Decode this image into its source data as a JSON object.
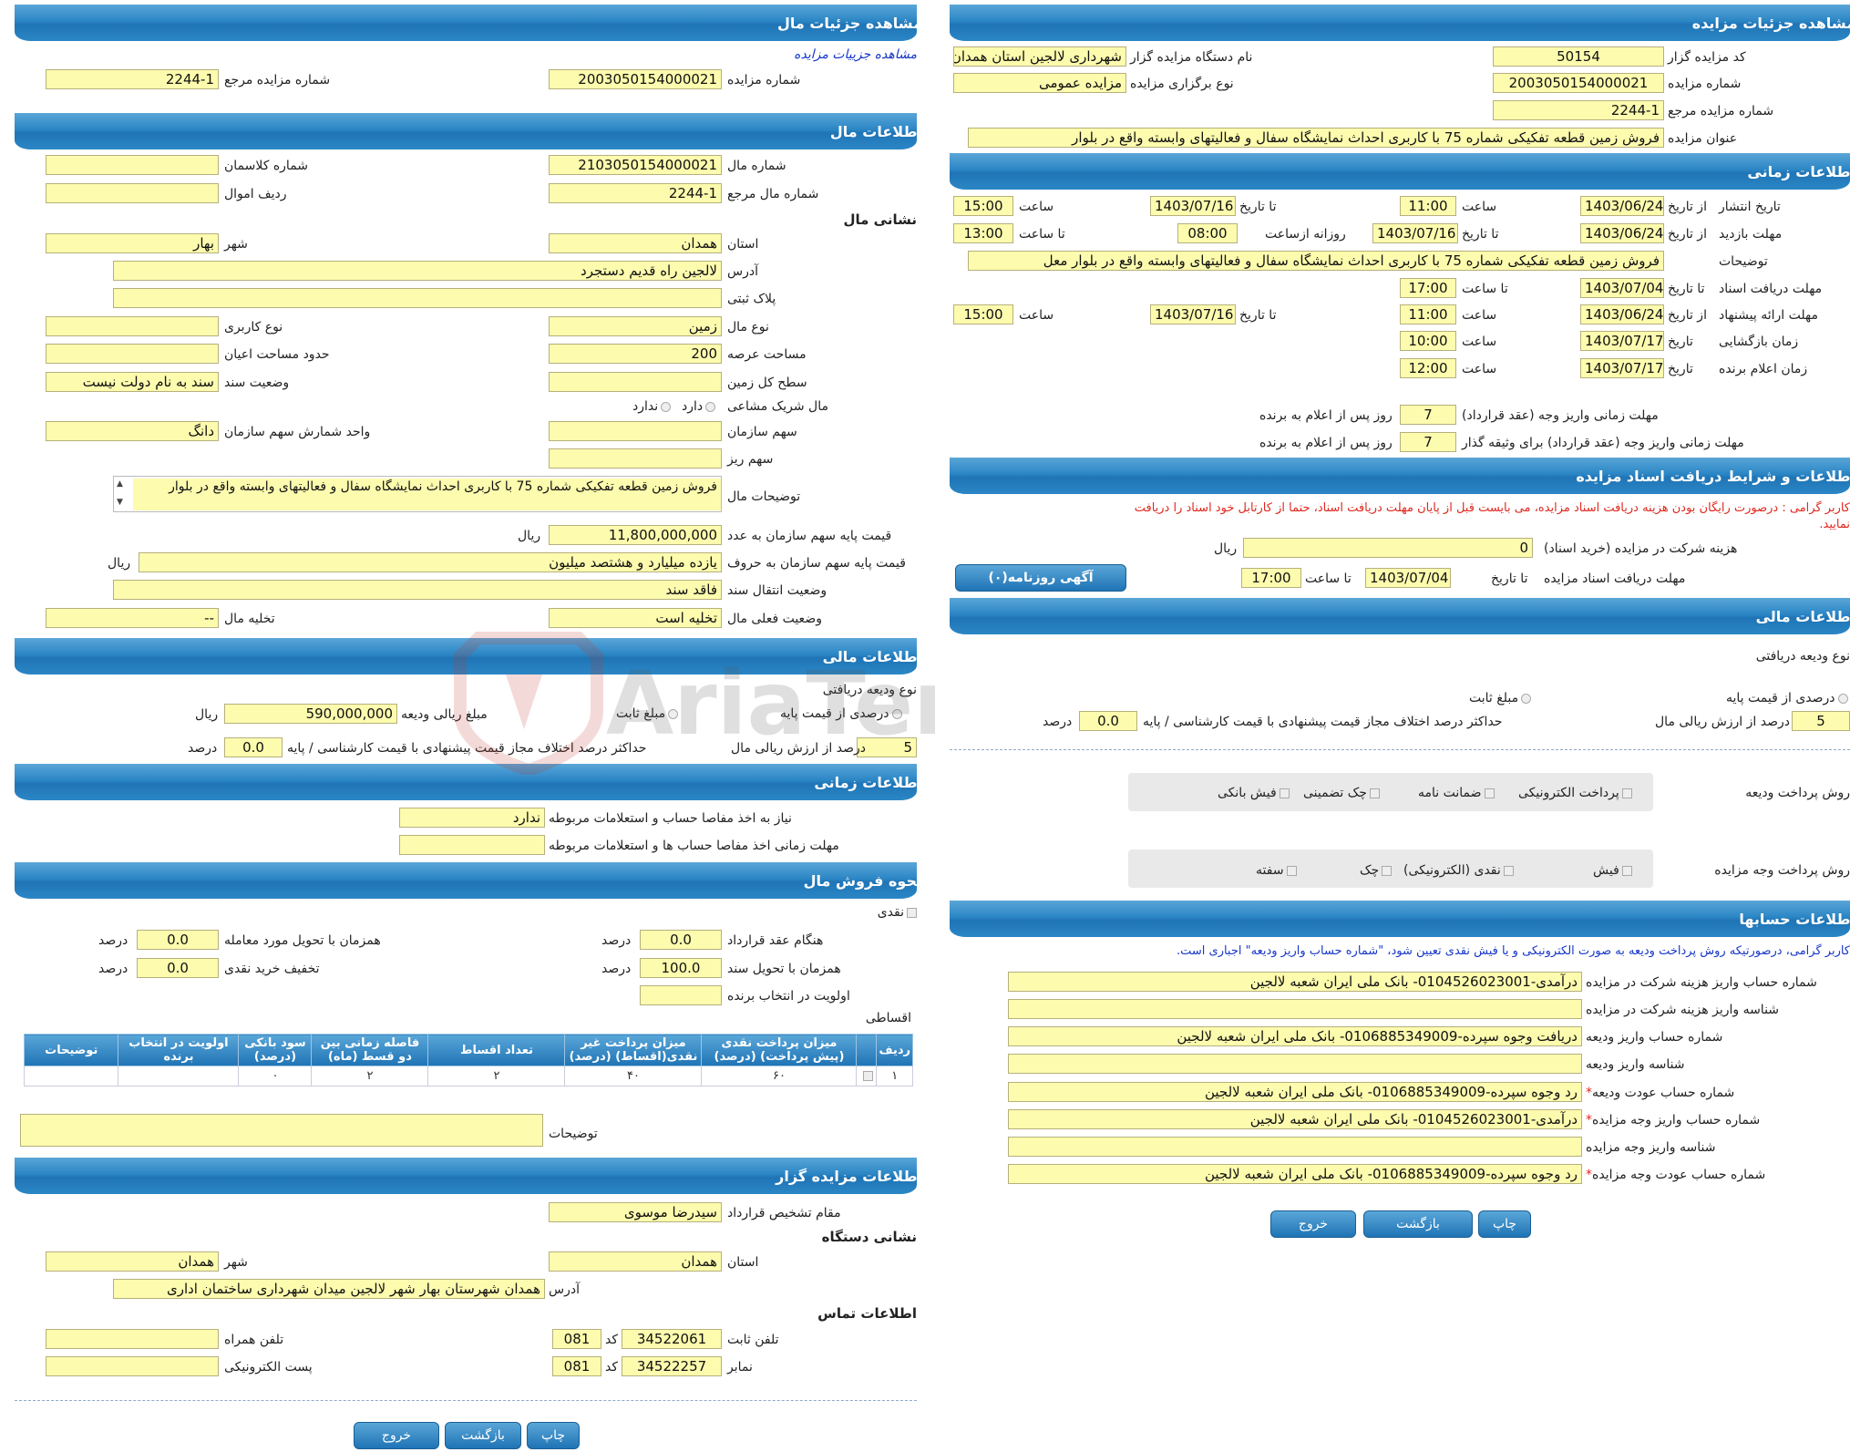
{
  "left": {
    "head_main": "مشاهده جزئیات مال",
    "link_details": "مشاهده جزییات مزایده",
    "auction_no_lbl": "شماره مزایده",
    "auction_no": "2003050154000021",
    "ref_no_lbl": "شماره مزایده مرجع",
    "ref_no": "2244-1",
    "head_property": "اطلاعات مال",
    "prop_no_lbl": "شماره مال",
    "prop_no": "2103050154000021",
    "class_no_lbl": "شماره کلاسمان",
    "class_no": "",
    "prop_ref_lbl": "شماره مال مرجع",
    "prop_ref": "2244-1",
    "asset_row_lbl": "ردیف اموال",
    "asset_row": "",
    "addr_head": "نشانی مال",
    "province_lbl": "استان",
    "province": "همدان",
    "city_lbl": "شهر",
    "city": "بهار",
    "address_lbl": "آدرس",
    "address": "لالجین راه قدیم دستجرد",
    "plate_lbl": "پلاک ثبتی",
    "plate": "",
    "type_lbl": "نوع مال",
    "type": "زمین",
    "usage_lbl": "نوع کاربری",
    "usage": "",
    "area_lbl": "مساحت عرصه",
    "area": "200",
    "bounds_lbl": "حدود مساحت اعیان",
    "bounds": "",
    "ground_lbl": "سطح کل زمین",
    "ground": "",
    "deed_lbl": "وضعیت سند",
    "deed": "سند به نام دولت نیست",
    "shared_lbl": "مال شریک مشاعی",
    "shared_yes": "دارد",
    "shared_no": "ندارد",
    "org_share_lbl": "سهم سازمان",
    "org_share": "",
    "unit_lbl": "واحد شمارش سهم سازمان",
    "unit": "دانگ",
    "minor_share_lbl": "سهم ریز",
    "minor_share": "",
    "desc_lbl": "توضیحات مال",
    "desc": "فروش زمین  قطعه تفکیکی شماره   75 با کاربری احداث نمایشگاه سفال و  فعالیتهای وابسته واقع در بلوار",
    "base_num_lbl": "قیمت پایه سهم سازمان به عدد",
    "base_num": "11,800,000,000",
    "rial": "ریال",
    "base_txt_lbl": "قیمت پایه سهم سازمان به حروف",
    "base_txt": "یازده میلیارد و هشتصد میلیون",
    "transfer_lbl": "وضعیت انتقال سند",
    "transfer": "فاقد سند",
    "status_lbl": "وضعیت فعلی مال",
    "status": "تخلیه است",
    "evac_lbl": "تخلیه مال",
    "evac": "--",
    "head_fin": "اطلاعات مالی",
    "dep_type": "نوع ودیعه دریافتی",
    "pct_base": "درصدی از قیمت پایه",
    "fixed": "مبلغ ثابت",
    "dep_amount_lbl": "مبلغ ریالی ودیعه",
    "dep_amount": "590,000,000",
    "pct_val": "5",
    "pct_lbl": "درصد از ارزش ریالی مال",
    "max_diff_lbl": "حداکثر درصد اختلاف مجاز قیمت پیشنهادی با قیمت کارشناسی / پایه",
    "max_diff": "0.0",
    "percent": "درصد",
    "head_time": "اطلاعات زمانی",
    "need_lbl": "نیاز به اخذ مفاصا حساب و استعلامات مربوطه",
    "need": "ندارد",
    "deadline_lbl": "مهلت زمانی اخذ مفاصا حساب ها و استعلامات مربوطه",
    "deadline": "",
    "head_sale": "نحوه فروش مال",
    "cash": "نقدی",
    "contract_lbl": "هنگام عقد قرارداد",
    "contract": "0.0",
    "delivery_lbl": "همزمان با تحویل مورد معامله",
    "delivery": "0.0",
    "deed_del_lbl": "همزمان با تحویل سند",
    "deed_del": "100.0",
    "discount_lbl": "تخفیف خرید نقدی",
    "discount": "0.0",
    "priority_lbl": "اولویت در انتخاب برنده",
    "priority": "",
    "installments": "اقساطی",
    "table_headers": [
      "ردیف",
      "",
      "میزان پرداخت نقدی (پیش پرداخت) (درصد)",
      "میزان پرداخت غیر نقدی(اقساط) (درصد)",
      "تعداد اقساط",
      "فاصله زمانی بین دو قسط (ماه)",
      "سود بانکی (درصد)",
      "اولویت در انتخاب برنده",
      "توضیحات"
    ],
    "table_row": [
      "۱",
      "",
      "۶۰",
      "۴۰",
      "۲",
      "۲",
      "۰",
      "",
      ""
    ],
    "notes_lbl": "توضیحات",
    "notes": "",
    "head_auctioneer": "اطلاعات مزایده گزار",
    "authority_lbl": "مقام تشخیص قرارداد",
    "authority": "سیدرضا موسوی",
    "dev_addr": "نشانی دستگاه",
    "d_province_lbl": "استان",
    "d_province": "همدان",
    "d_city_lbl": "شهر",
    "d_city": "همدان",
    "d_address_lbl": "آدرس",
    "d_address": "همدان شهرستان بهار شهر لالجین میدان شهرداری ساختمان اداری",
    "contact": "اطلاعات تماس",
    "phone_lbl": "تلفن ثابت",
    "phone": "34522061",
    "code_lbl": "کد",
    "phone_code": "081",
    "mobile_lbl": "تلفن همراه",
    "mobile": "",
    "fax_lbl": "نمابر",
    "fax": "34522257",
    "fax_code": "081",
    "email_lbl": "پست الکترونیکی",
    "email": "",
    "btn_print": "چاپ",
    "btn_back": "بازگشت",
    "btn_exit": "خروج"
  },
  "right": {
    "head_main": "مشاهده جزئیات مزایده",
    "code_lbl": "کد مزایده گزار",
    "code": "50154",
    "org_lbl": "نام دستگاه مزایده گزار",
    "org": "شهرداری لالجین استان همدان",
    "auction_no_lbl": "شماره مزایده",
    "auction_no": "2003050154000021",
    "type_lbl": "نوع برگزاری مزایده",
    "type": "مزایده عمومی",
    "ref_lbl": "شماره مزایده مرجع",
    "ref": "2244-1",
    "title_lbl": "عنوان مزایده",
    "title": "فروش زمین  قطعه تفکیکی شماره   75 با کاربری احداث نمایشگاه سفال و  فعالیتهای وابسته واقع در بلوار",
    "head_time": "اطلاعات زمانی",
    "pub_lbl": "تاریخ انتشار",
    "from_date": "از تاریخ",
    "to_date": "تا تاریخ",
    "hour": "ساعت",
    "to_hour": "تا ساعت",
    "pub_from": "1403/06/24",
    "pub_from_h": "11:00",
    "pub_to": "1403/07/16",
    "pub_to_h": "15:00",
    "visit_lbl": "مهلت بازدید",
    "visit_from": "1403/06/24",
    "visit_to": "1403/07/16",
    "daily_lbl": "روزانه ازساعت",
    "visit_h1": "08:00",
    "visit_h2": "13:00",
    "desc_lbl": "توضیحات",
    "desc": "فروش زمین  قطعه تفکیکی شماره   75 با کاربری احداث نمایشگاه سفال و  فعالیتهای وابسته واقع در بلوار   معل",
    "doc_lbl": "مهلت دریافت اسناد",
    "doc_to": "1403/07/04",
    "doc_h": "17:00",
    "offer_lbl": "مهلت ارائه پیشنهاد",
    "offer_from": "1403/06/24",
    "offer_from_h": "11:00",
    "offer_to": "1403/07/16",
    "offer_to_h": "15:00",
    "open_lbl": "زمان بازگشایی",
    "date_lbl": "تاریخ",
    "open": "1403/07/17",
    "open_h": "10:00",
    "winner_lbl": "زمان اعلام برنده",
    "winner": "1403/07/17",
    "winner_h": "12:00",
    "pay1_lbl": "مهلت زمانی واریز وجه (عقد قرارداد)",
    "pay1": "7",
    "pay1_sfx": "روز پس از اعلام به برنده",
    "pay2_lbl": "مهلت زمانی واریز وجه (عقد قرارداد) برای وثیقه گذار",
    "pay2": "7",
    "pay2_sfx": "روز پس از اعلام به برنده",
    "head_docs": "اطلاعات و شرایط دریافت اسناد مزایده",
    "warn1": "کاربر گرامی : درصورت رایگان بودن هزینه دریافت اسناد مزایده، می بایست قبل از پایان مهلت دریافت اسناد، حتما از کارتابل خود اسناد را دریافت",
    "warn2": "نمایید.",
    "fee_lbl": "هزینه شرکت در مزایده (خرید اسناد)",
    "fee": "0",
    "rial": "ریال",
    "doc_deadline_lbl": "مهلت دریافت اسناد مزایده",
    "dd_to": "1403/07/04",
    "dd_h": "17:00",
    "btn_news": "آگهی روزنامه(۰)",
    "head_fin": "اطلاعات مالی",
    "dep_type": "نوع ودیعه دریافتی",
    "pct_base": "درصدی از قیمت پایه",
    "fixed": "مبلغ ثابت",
    "pct": "5",
    "pct_lbl": "درصد از ارزش ریالی مال",
    "max_diff_lbl": "حداکثر درصد اختلاف مجاز قیمت پیشنهادی با قیمت کارشناسی / پایه",
    "max_diff": "0.0",
    "percent": "درصد",
    "dep_method_lbl": "روش پرداخت ودیعه",
    "dep_methods": [
      "پرداخت الکترونیکی",
      "ضمانت نامه",
      "چک تضمینی",
      "فیش بانکی"
    ],
    "pay_method_lbl": "روش پرداخت وجه مزایده",
    "pay_methods": [
      "فیش",
      "نقدی (الکترونیکی)",
      "چک",
      "سفته"
    ],
    "head_acc": "اطلاعات حسابها",
    "acc_note": "کاربر گرامی، درصورتیکه روش پرداخت ودیعه به صورت الکترونیکی و یا فیش نقدی تعیین شود، \"شماره حساب واریز ودیعه\" اجباری است.",
    "acc1_lbl": "شماره حساب واریز هزینه شرکت در مزایده",
    "acc1": "درآمدی-0104526023001- بانک ملی ایران شعبه لالجین",
    "acc2_lbl": "شناسه واریز هزینه شرکت در مزایده",
    "acc2": "",
    "acc3_lbl": "شماره حساب واریز ودیعه",
    "acc3": "دریافت وجوه سپرده-0106885349009- بانک ملی ایران شعبه لالجین",
    "acc4_lbl": "شناسه واریز ودیعه",
    "acc4": "",
    "acc5_lbl": "شماره حساب عودت ودیعه",
    "acc5": "رد وجوه سپرده-0106885349009- بانک ملی ایران شعبه لالجین",
    "acc6_lbl": "شماره حساب واریز وجه مزایده",
    "acc6": "درآمدی-0104526023001- بانک ملی ایران شعبه لالجین",
    "acc7_lbl": "شناسه واریز وجه مزایده",
    "acc7": "",
    "acc8_lbl": "شماره حساب عودت وجه مزایده",
    "acc8": "رد وجوه سپرده-0106885349009- بانک ملی ایران شعبه لالجین",
    "star": "*",
    "btn_print": "چاپ",
    "btn_back": "بازگشت",
    "btn_exit": "خروج"
  },
  "watermark": "AriaTender.neT",
  "colors": {
    "header": "#2b86c5",
    "field": "#fdfbae",
    "warn": "#e0281e",
    "note": "#1737c8"
  }
}
